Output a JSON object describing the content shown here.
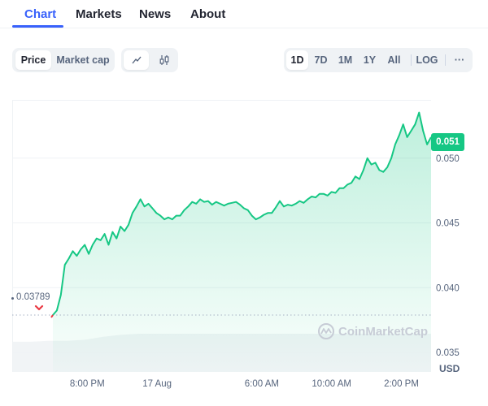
{
  "tabs": [
    {
      "label": "Chart",
      "active": true
    },
    {
      "label": "Markets",
      "active": false
    },
    {
      "label": "News",
      "active": false
    },
    {
      "label": "About",
      "active": false
    }
  ],
  "toolbar": {
    "metric_toggle": [
      {
        "label": "Price",
        "active": true
      },
      {
        "label": "Market cap",
        "active": false
      }
    ],
    "chart_type_toggle": [
      {
        "icon": "line-chart-icon",
        "active": true
      },
      {
        "icon": "candlestick-icon",
        "active": false
      }
    ],
    "range_buttons": [
      {
        "label": "1D",
        "active": true
      },
      {
        "label": "7D",
        "active": false
      },
      {
        "label": "1M",
        "active": false
      },
      {
        "label": "1Y",
        "active": false
      },
      {
        "label": "All",
        "active": false
      }
    ],
    "log_label": "LOG",
    "more_label": "···"
  },
  "current_price_label": "0.051",
  "open_price_label": "0.03789",
  "currency_label": "USD",
  "watermark": "CoinMarketCap",
  "colors": {
    "accent": "#3861fb",
    "up": "#16c784",
    "down": "#ea3943",
    "axis_text": "#58667e"
  },
  "chart_data": {
    "type": "area",
    "title": "",
    "xlabel": "",
    "ylabel": "USD",
    "ylim": [
      0.0335,
      0.0545
    ],
    "y_ticks": [
      {
        "value": 0.05,
        "label": "0.050"
      },
      {
        "value": 0.045,
        "label": "0.045"
      },
      {
        "value": 0.04,
        "label": "0.040"
      },
      {
        "value": 0.035,
        "label": "0.035"
      }
    ],
    "x_range_hours": [
      0,
      24
    ],
    "x_ticks": [
      {
        "t": 4.3,
        "label": "8:00 PM"
      },
      {
        "t": 8.3,
        "label": "17 Aug"
      },
      {
        "t": 14.3,
        "label": "6:00 AM"
      },
      {
        "t": 18.3,
        "label": "10:00 AM"
      },
      {
        "t": 22.3,
        "label": "2:00 PM"
      }
    ],
    "baseline": 0.03789,
    "grid": true,
    "series": [
      {
        "name": "Price",
        "values": [
          0.03789,
          0.03824,
          0.03944,
          0.04176,
          0.04225,
          0.04282,
          0.04246,
          0.04296,
          0.04331,
          0.04261,
          0.04331,
          0.0438,
          0.04366,
          0.04415,
          0.04331,
          0.0443,
          0.0438,
          0.04472,
          0.04437,
          0.04486,
          0.04577,
          0.04627,
          0.04683,
          0.04627,
          0.04648,
          0.04613,
          0.04577,
          0.04556,
          0.04528,
          0.04542,
          0.04528,
          0.04556,
          0.04556,
          0.04599,
          0.04627,
          0.04662,
          0.04648,
          0.04683,
          0.04662,
          0.04669,
          0.04641,
          0.04662,
          0.04648,
          0.04634,
          0.04648,
          0.04655,
          0.04662,
          0.04641,
          0.04613,
          0.04599,
          0.04556,
          0.04528,
          0.04542,
          0.04563,
          0.04577,
          0.04577,
          0.0462,
          0.04669,
          0.04627,
          0.04641,
          0.04634,
          0.04648,
          0.04669,
          0.04655,
          0.04683,
          0.04704,
          0.04697,
          0.04725,
          0.04725,
          0.04711,
          0.04739,
          0.04732,
          0.04768,
          0.04768,
          0.04796,
          0.0481,
          0.04859,
          0.04838,
          0.04908,
          0.05,
          0.04951,
          0.04965,
          0.04908,
          0.04894,
          0.0493,
          0.05,
          0.05106,
          0.05176,
          0.05261,
          0.05162,
          0.05211,
          0.05261,
          0.05352,
          0.05211,
          0.05106,
          0.05162
        ]
      }
    ],
    "volume_profile": [
      0.3,
      0.3,
      0.31,
      0.31,
      0.32,
      0.35,
      0.37,
      0.38,
      0.38,
      0.38,
      0.38,
      0.38,
      0.38,
      0.38,
      0.38,
      0.38,
      0.38,
      0.38,
      0.38,
      0.38,
      0.38,
      0.38,
      0.38,
      0.38
    ]
  }
}
